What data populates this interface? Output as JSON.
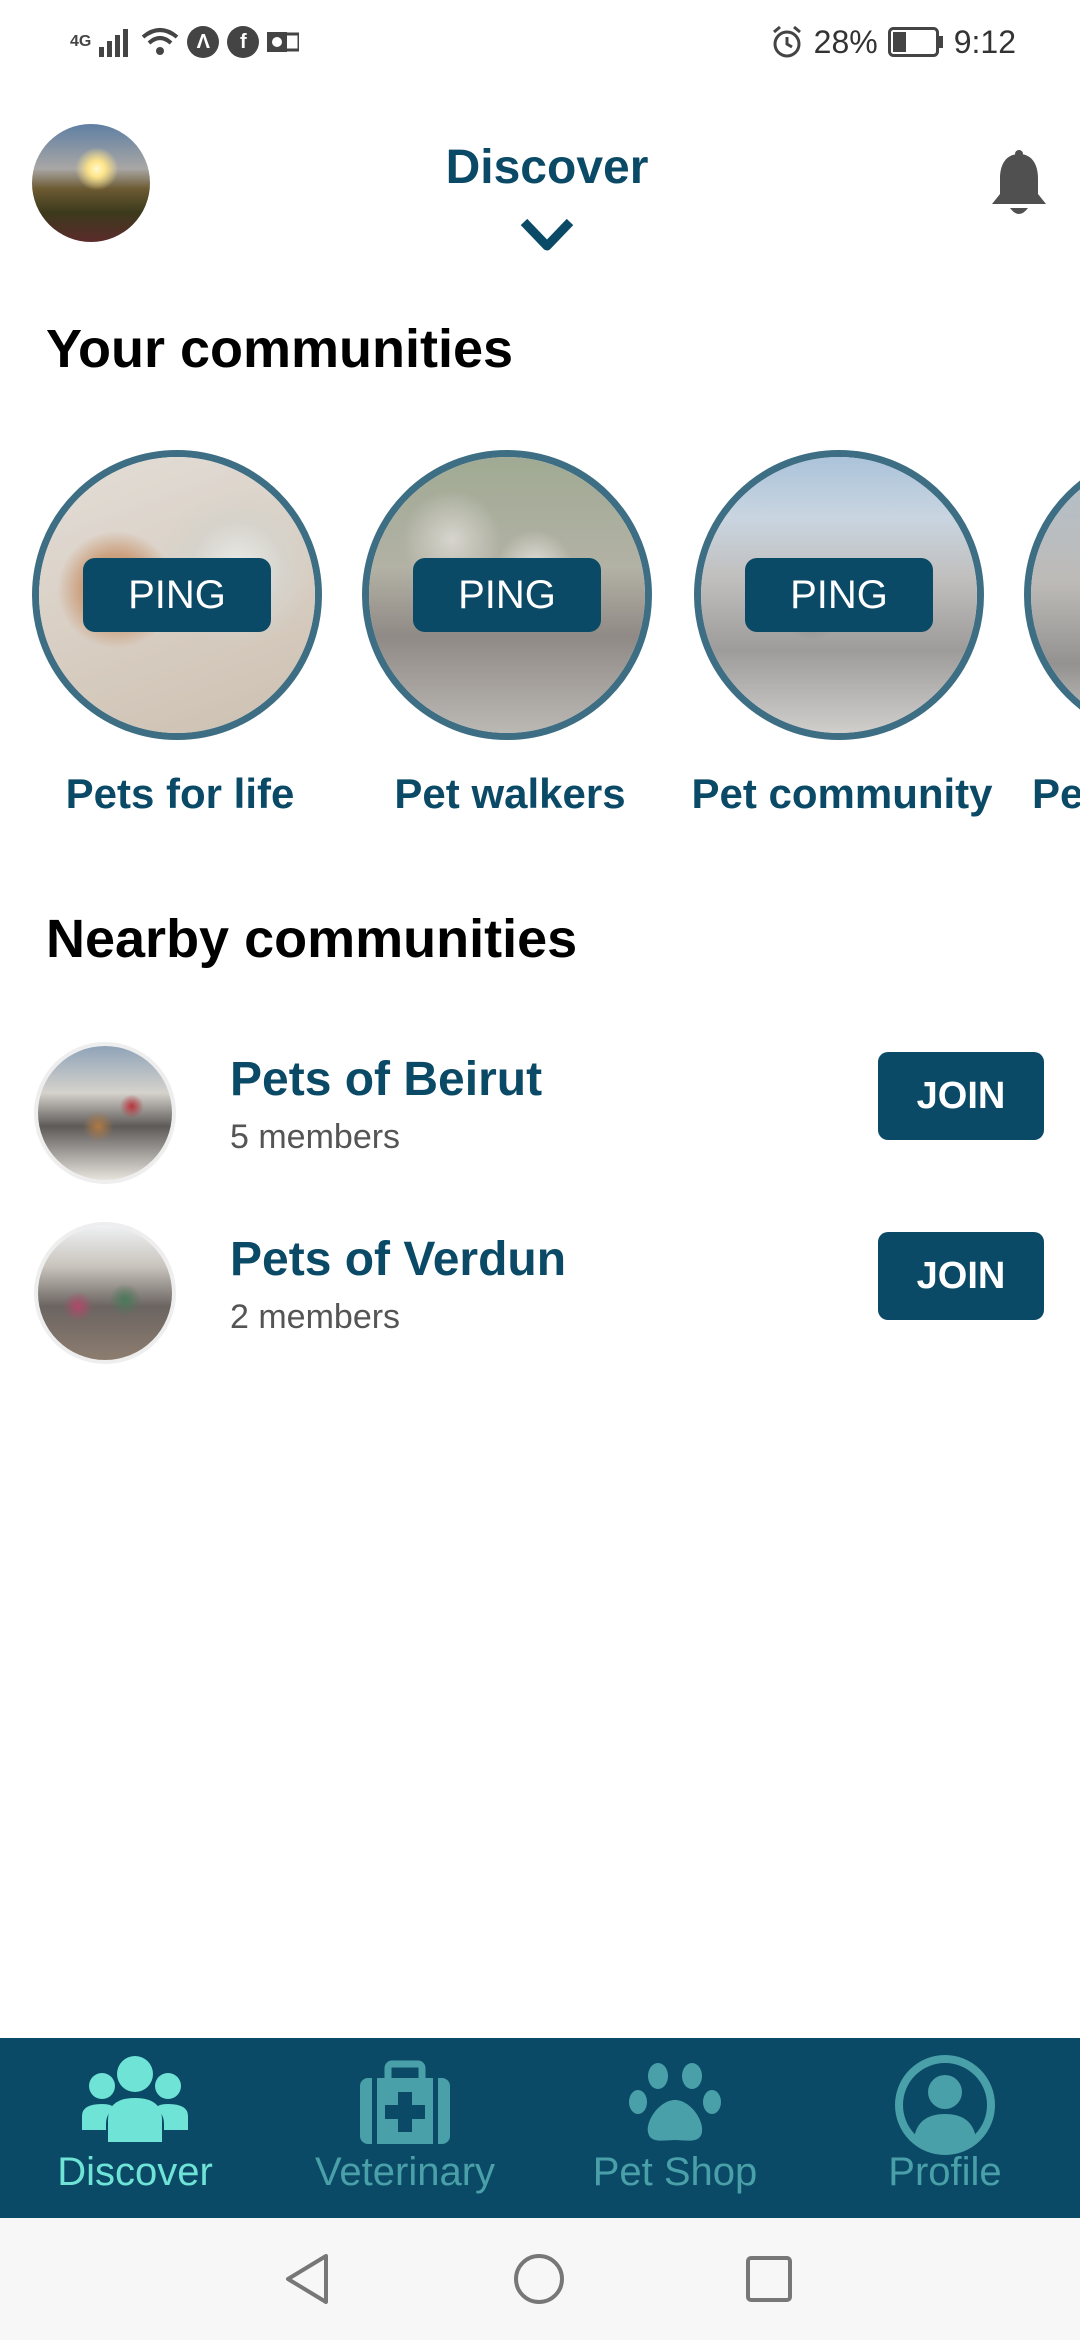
{
  "status_bar": {
    "network": "4G",
    "battery": "28%",
    "time": "9:12"
  },
  "header": {
    "title": "Discover"
  },
  "your_communities": {
    "title": "Your communities",
    "items": [
      {
        "name": "Pets for life",
        "action": "PING"
      },
      {
        "name": "Pet walkers",
        "action": "PING"
      },
      {
        "name": "Pet community",
        "action": "PING"
      },
      {
        "name": "Pe"
      }
    ]
  },
  "nearby_communities": {
    "title": "Nearby communities",
    "items": [
      {
        "name": "Pets of Beirut",
        "members": "5 members",
        "action": "JOIN"
      },
      {
        "name": "Pets of Verdun",
        "members": "2 members",
        "action": "JOIN"
      }
    ]
  },
  "bottom_nav": {
    "items": [
      {
        "label": "Discover",
        "icon": "users-icon",
        "active": true
      },
      {
        "label": "Veterinary",
        "icon": "medical-kit-icon",
        "active": false
      },
      {
        "label": "Pet Shop",
        "icon": "paw-icon",
        "active": false
      },
      {
        "label": "Profile",
        "icon": "user-circle-icon",
        "active": false
      }
    ]
  },
  "colors": {
    "primary": "#0b4a66",
    "active_nav": "#6fe3d6",
    "inactive_nav": "#4aa0a8"
  }
}
